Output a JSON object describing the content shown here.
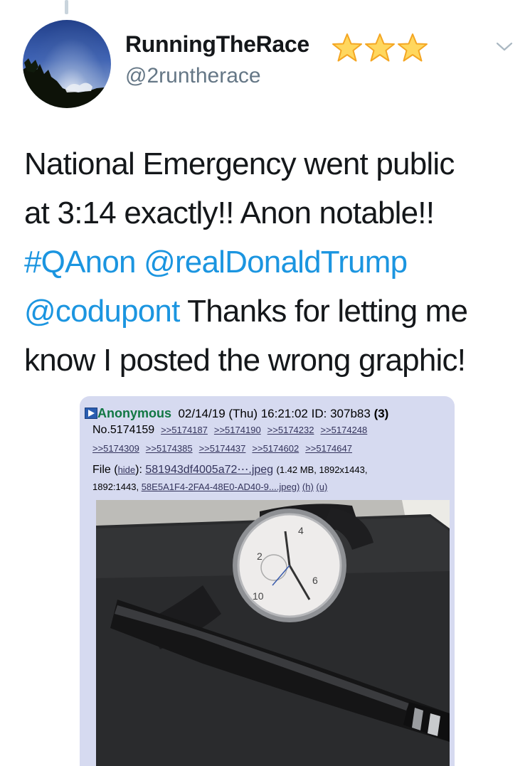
{
  "tweet": {
    "display_name": "RunningTheRace",
    "handle": "@2runtherace",
    "text_line1": "National Emergency went public",
    "text_line2": "at 3:14 exactly!! Anon notable!!",
    "hashtag": "#QAnon",
    "mention1": "@realDonaldTrump",
    "mention2": "@codupont",
    "text_after_mention": " Thanks for letting me",
    "text_line5": "know I posted the wrong graphic!",
    "badge_icons": [
      "star-icon",
      "star-icon",
      "star-icon"
    ],
    "link_color": "#1b95e0"
  },
  "post": {
    "name": "Anonymous",
    "datetime": "02/14/19 (Thu) 16:21:02",
    "id_label": "ID:",
    "id_value": "307b83",
    "id_count": "(3)",
    "number": "No.5174159",
    "backlinks_row1": [
      ">>5174187",
      ">>5174190",
      ">>5174232",
      ">>5174248"
    ],
    "backlinks_row2": [
      ">>5174309",
      ">>5174385",
      ">>5174437",
      ">>5174602",
      ">>5174647"
    ],
    "file_label": "File (",
    "hide_label": "hide",
    "file_label_close": "): ",
    "file_name": "581943df4005a72⋯.jpeg",
    "file_meta": "(1.42 MB, 1892x1443,",
    "file_meta2": "1892:1443,",
    "file_original": "58E5A1F4-2FA4-48E0-AD40-9....jpeg)",
    "h_link": "(h)",
    "u_link": "(u)",
    "name_color": "#117743",
    "background_color": "#d6daf0"
  }
}
